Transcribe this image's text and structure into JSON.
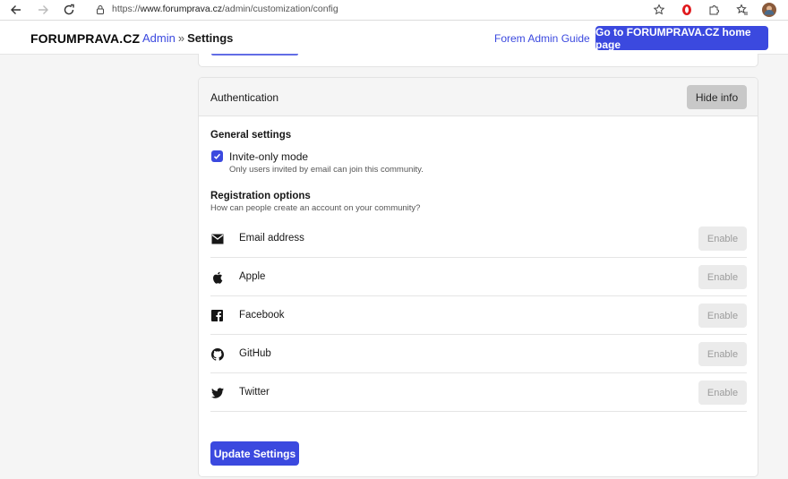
{
  "browser": {
    "url_prefix": "https://",
    "url_host": "www.forumprava.cz",
    "url_path": "/admin/customization/config"
  },
  "header": {
    "brand": "FORUMPRAVA.CZ",
    "breadcrumb_admin": "Admin",
    "breadcrumb_sep": "»",
    "breadcrumb_current": "Settings",
    "guide_link": "Forem Admin Guide",
    "home_button": "Go to FORUMPRAVA.CZ home page"
  },
  "auth": {
    "title": "Authentication",
    "hide_button": "Hide info",
    "general_title": "General settings",
    "invite_only_label": "Invite-only mode",
    "invite_only_checked": true,
    "invite_only_help": "Only users invited by email can join this community.",
    "registration_title": "Registration options",
    "registration_help": "How can people create an account on your community?",
    "providers": [
      {
        "name": "Email address",
        "icon": "mail-icon",
        "button": "Enable"
      },
      {
        "name": "Apple",
        "icon": "apple-icon",
        "button": "Enable"
      },
      {
        "name": "Facebook",
        "icon": "facebook-icon",
        "button": "Enable"
      },
      {
        "name": "GitHub",
        "icon": "github-icon",
        "button": "Enable"
      },
      {
        "name": "Twitter",
        "icon": "twitter-icon",
        "button": "Enable"
      }
    ],
    "update_button": "Update Settings"
  },
  "colors": {
    "accent": "#3b49df",
    "card_border": "#e3e3e3",
    "page_bg": "#f5f5f5"
  }
}
